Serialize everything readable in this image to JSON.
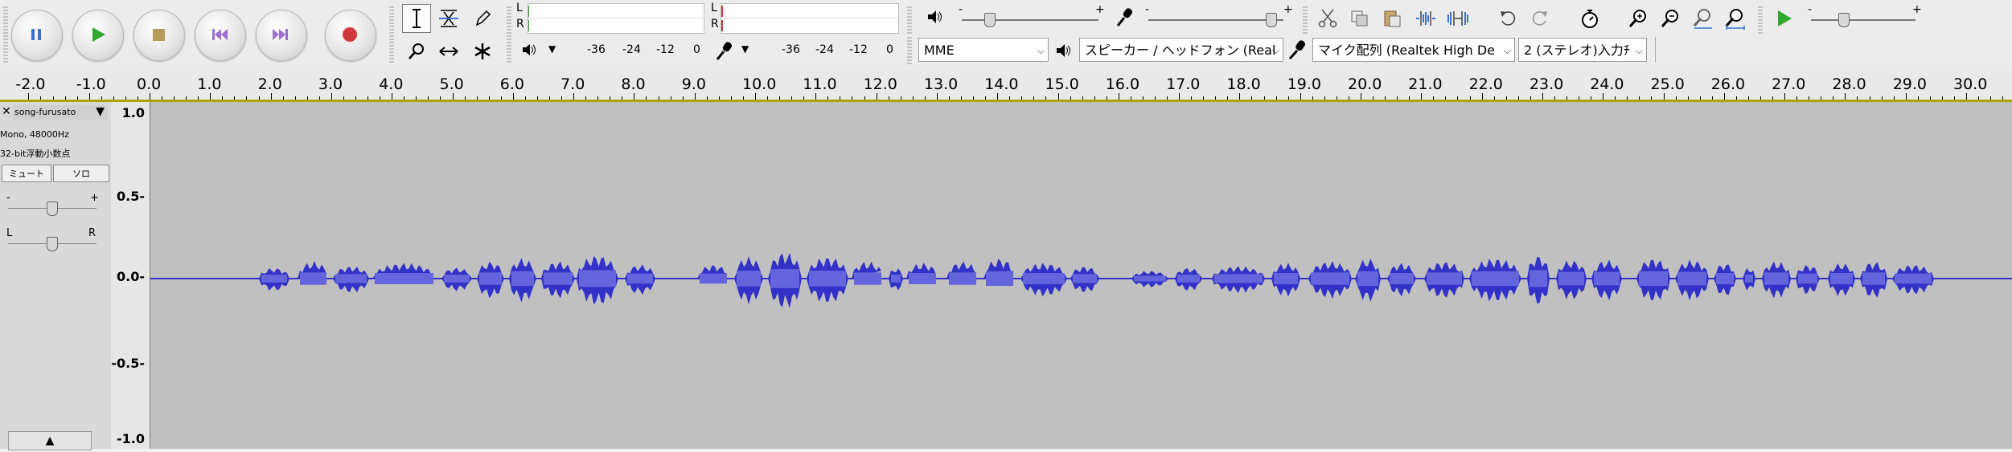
{
  "transport": {
    "pause_label": "Pause",
    "play_label": "Play",
    "stop_label": "Stop",
    "skip_start_label": "Skip to Start",
    "skip_end_label": "Skip to End",
    "record_label": "Record"
  },
  "meters": {
    "playback_L": "L",
    "playback_R": "R",
    "record_L": "L",
    "record_R": "R",
    "playback_scale": [
      "-36",
      "-24",
      "-12",
      "0"
    ],
    "record_scale": [
      "-36",
      "-24",
      "-12",
      "0"
    ]
  },
  "mixer": {
    "play_minus": "-",
    "play_plus": "+",
    "rec_minus": "-",
    "rec_plus": "+",
    "speed_minus": "-",
    "speed_plus": "+"
  },
  "device": {
    "host": "MME",
    "output": "スピーカー / ヘッドフォン (Real",
    "input": "マイク配列 (Realtek High De",
    "channels": "2 (ステレオ)入力ﾁ"
  },
  "ruler": {
    "ticks": [
      "-2.0",
      "-1.0",
      "0.0",
      "1.0",
      "2.0",
      "3.0",
      "4.0",
      "5.0",
      "6.0",
      "7.0",
      "8.0",
      "9.0",
      "10.0",
      "11.0",
      "12.0",
      "13.0",
      "14.0",
      "15.0",
      "16.0",
      "17.0",
      "18.0",
      "19.0",
      "20.0",
      "21.0",
      "22.0",
      "23.0",
      "24.0",
      "25.0",
      "26.0",
      "27.0",
      "28.0",
      "29.0",
      "30.0"
    ]
  },
  "track": {
    "name": "song-furusato",
    "info1": "Mono, 48000Hz",
    "info2": "32-bit浮動小数点",
    "mute": "ミュート",
    "solo": "ソロ",
    "gain_minus": "-",
    "gain_plus": "+",
    "pan_L": "L",
    "pan_R": "R",
    "vruler": [
      "1.0",
      "0.5-",
      "0.0-",
      "-0.5-",
      "-1.0"
    ]
  },
  "colors": {
    "wave": "#3232c8",
    "wave_light": "#6464dc",
    "background": "#c0c0c0"
  }
}
